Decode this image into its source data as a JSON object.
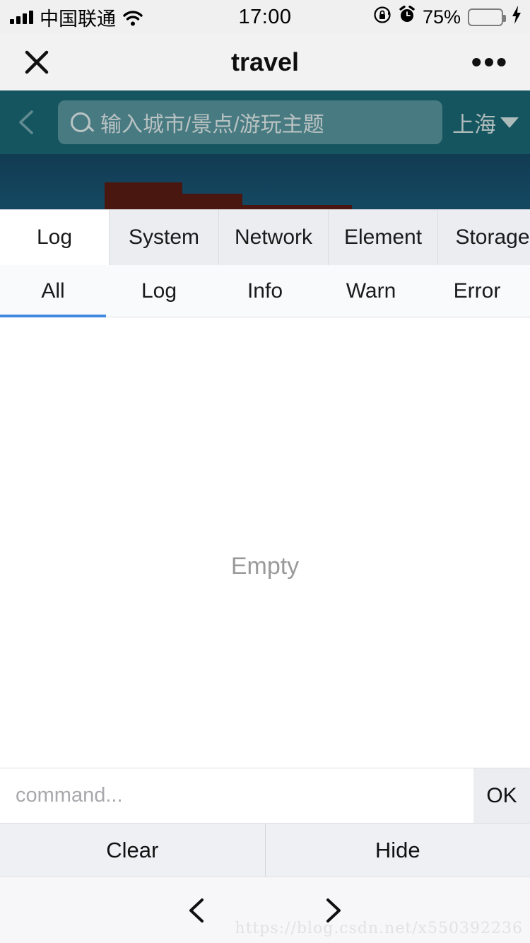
{
  "status_bar": {
    "carrier": "中国联通",
    "time": "17:00",
    "battery_percent": "75%",
    "battery_level": 75,
    "icons": [
      "signal-bars-icon",
      "wifi-icon",
      "rotation-lock-icon",
      "alarm-clock-icon",
      "battery-icon",
      "charging-bolt-icon"
    ]
  },
  "nav_bar": {
    "title": "travel",
    "close_icon": "close-icon",
    "more_icon": "more-options-icon"
  },
  "search": {
    "back_icon": "chevron-left-icon",
    "placeholder": "输入城市/景点/游玩主题",
    "value": "",
    "city": "上海",
    "city_caret": "caret-down-icon"
  },
  "vconsole": {
    "tabs": [
      {
        "label": "Log",
        "active": true
      },
      {
        "label": "System",
        "active": false
      },
      {
        "label": "Network",
        "active": false
      },
      {
        "label": "Element",
        "active": false
      },
      {
        "label": "Storage",
        "active": false
      },
      {
        "label": "",
        "active": false
      }
    ],
    "filters": [
      {
        "label": "All",
        "active": true
      },
      {
        "label": "Log",
        "active": false
      },
      {
        "label": "Info",
        "active": false
      },
      {
        "label": "Warn",
        "active": false
      },
      {
        "label": "Error",
        "active": false
      }
    ],
    "log_entries": [],
    "empty_text": "Empty",
    "command": {
      "placeholder": "command...",
      "value": "",
      "submit_label": "OK"
    },
    "footer": {
      "clear_label": "Clear",
      "hide_label": "Hide"
    },
    "active_underline_color": "#4089e0"
  },
  "toolbar": {
    "back_icon": "chevron-left-icon",
    "forward_icon": "chevron-right-icon"
  },
  "watermark": "https://blog.csdn.net/x550392236",
  "colors": {
    "search_bar_bg": "#15555f",
    "banner_bg": "#15506b",
    "status_bar_bg": "#f0f0f0",
    "nav_bar_bg": "#f2f2f2",
    "tab_inactive_bg": "#ebedf1",
    "accent_blue": "#4089e0",
    "battery_green": "#4cd964"
  }
}
